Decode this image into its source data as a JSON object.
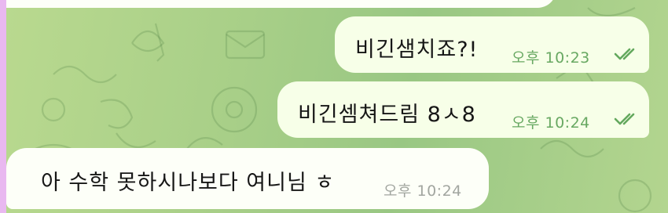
{
  "messages": [
    {
      "direction": "out",
      "text": "비긴샘치죠?!",
      "time": "오후 10:23",
      "status": "read"
    },
    {
      "direction": "out",
      "text": "비긴셈쳐드림 8ㅅ8",
      "time": "오후 10:24",
      "status": "read"
    },
    {
      "direction": "in",
      "text": "아 수학 못하시나보다 여니님 ㅎ",
      "time": "오후 10:24"
    }
  ],
  "colors": {
    "outgoing_bubble": "#f7ffe8",
    "incoming_bubble": "#fdfff8",
    "read_check": "#63a85d",
    "wallpaper": "#a8cf88"
  },
  "icons": {
    "read_receipt": "double-check-icon"
  }
}
